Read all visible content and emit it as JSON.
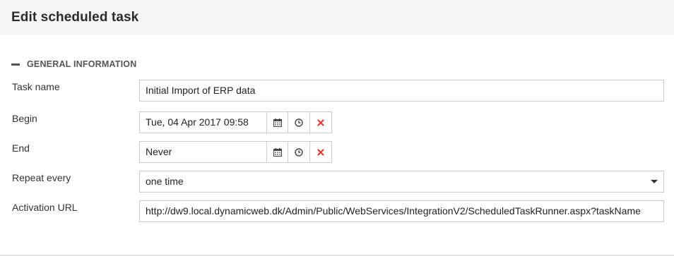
{
  "page": {
    "title": "Edit scheduled task"
  },
  "section": {
    "label": "GENERAL INFORMATION"
  },
  "fields": {
    "task_name": {
      "label": "Task name",
      "value": "Initial Import of ERP data"
    },
    "begin": {
      "label": "Begin",
      "value": "Tue, 04 Apr 2017 09:58"
    },
    "end": {
      "label": "End",
      "value": "Never"
    },
    "repeat": {
      "label": "Repeat every",
      "value": "one time"
    },
    "activation_url": {
      "label": "Activation URL",
      "value": "http://dw9.local.dynamicweb.dk/Admin/Public/WebServices/IntegrationV2/ScheduledTaskRunner.aspx?taskName"
    }
  },
  "icons": {
    "calendar": "calendar-icon",
    "clock": "clock-icon",
    "clear": "close-icon"
  },
  "colors": {
    "header_bg": "#f5f5f5",
    "clear_red": "#e53935",
    "border": "#cccccc"
  }
}
